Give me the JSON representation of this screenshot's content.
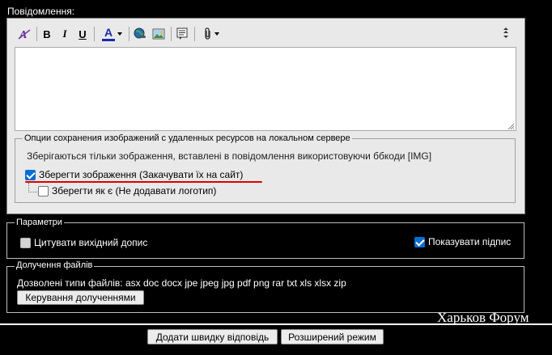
{
  "message": {
    "label": "Повідомлення:"
  },
  "toolbar": {
    "bold_label": "B",
    "italic_label": "I",
    "underline_label": "U",
    "font_color_label": "A",
    "font_color_accent": "#1a2aa8"
  },
  "image_options": {
    "legend": "Опции сохранения изображений с удаленных ресурсов на локальном сервере",
    "info": "Зберігаються тільки зображення, вставлені в повідомлення використовуючи ббкоди [IMG]",
    "save_images_label": "Зберегти зображення (Закачувати їх на сайт)",
    "save_images_checked": true,
    "save_as_is_label": "Зберегти як є (Не додавати логотип)",
    "save_as_is_checked": false
  },
  "params": {
    "legend": "Параметри",
    "quote_label": "Цитувати вихідний допис",
    "quote_checked": false,
    "signature_label": "Показувати підпис",
    "signature_checked": true
  },
  "attachments": {
    "legend": "Долучення файлів",
    "allowed_types": "Дозволені типи файлів: asx doc docx jpe jpeg jpg pdf png rar txt xls xlsx zip",
    "manage_button": "Керування долученнями"
  },
  "watermark": "Харьков Форум",
  "actions": {
    "quick_reply": "Додати швидку відповідь",
    "advanced_mode": "Розширений режим"
  },
  "colors": {
    "accent_checkbox": "#0a6ed1",
    "highlight_underline": "#e00000",
    "page_background": "#000000"
  }
}
